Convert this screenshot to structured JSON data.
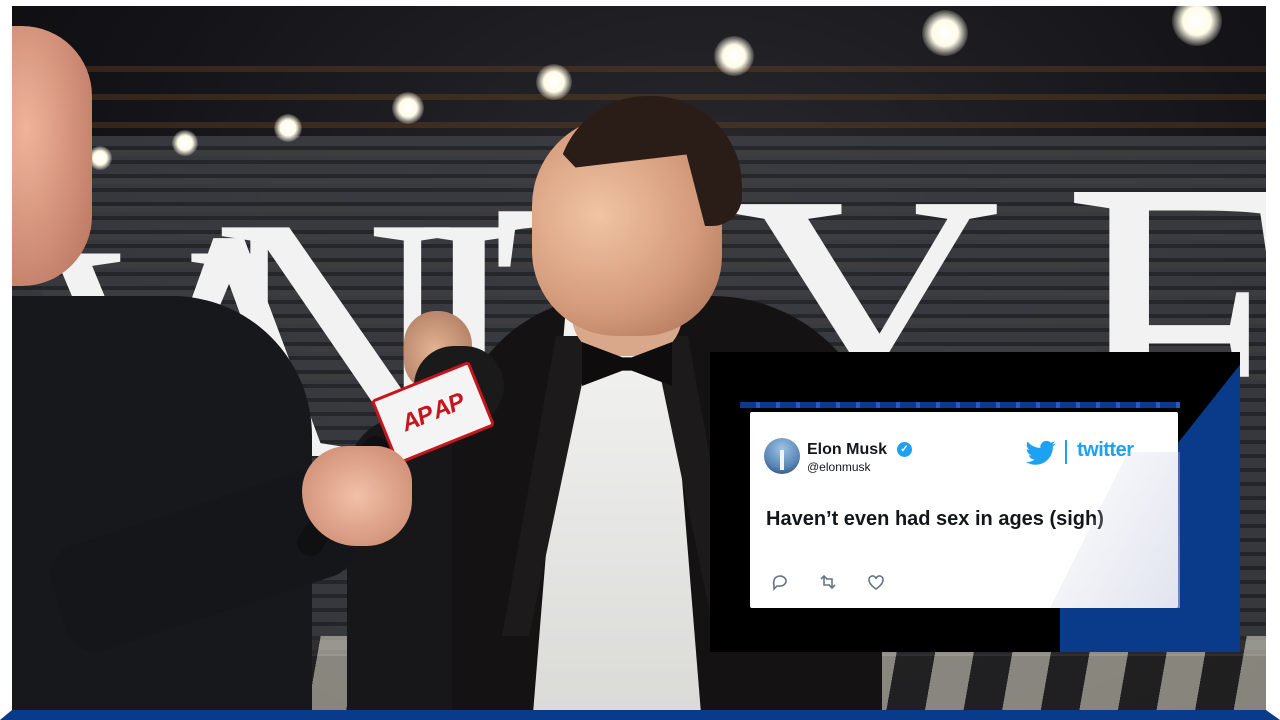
{
  "scene": {
    "backdrop_letters": [
      "V",
      "A",
      "N",
      "I",
      "T",
      "Y",
      "F"
    ],
    "microphone_flag": [
      "AP",
      "AP"
    ]
  },
  "tweet": {
    "user_name": "Elon Musk",
    "user_handle": "@elonmusk",
    "brand": "twitter",
    "text": "Haven’t even had sex in ages (sigh)",
    "actions": [
      "reply-icon",
      "retweet-icon",
      "like-icon"
    ]
  },
  "colors": {
    "overlay_blue": "#0a3a8a",
    "twitter_blue": "#1da1f2",
    "ap_red": "#c4161c"
  }
}
